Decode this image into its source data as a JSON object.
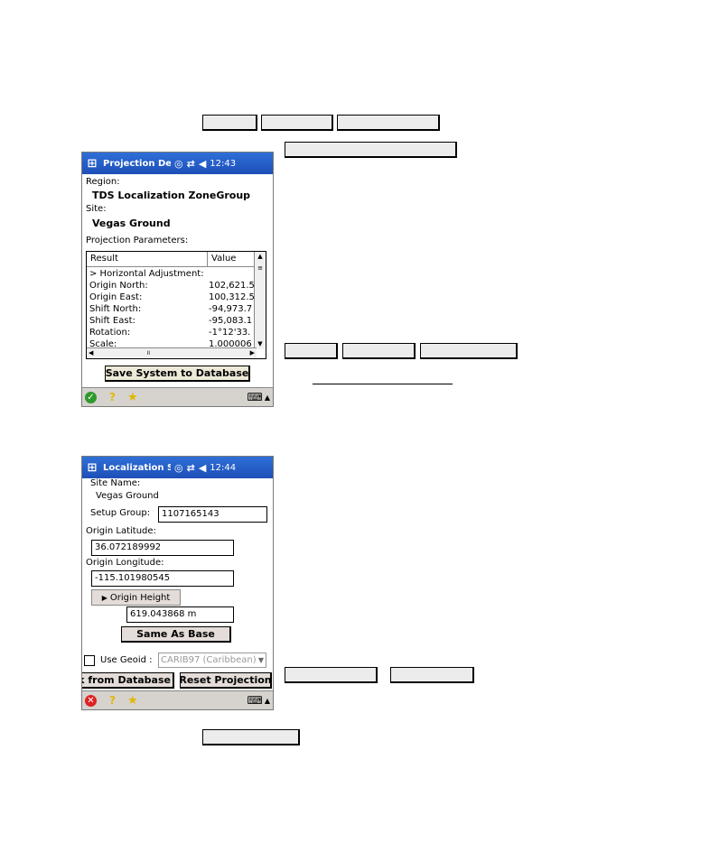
{
  "screen1": {
    "title": "Projection Det",
    "time": "12:43",
    "region_label": "Region:",
    "region_value": "TDS Localization ZoneGroup",
    "site_label": "Site:",
    "site_value": "Vegas Ground",
    "params_label": "Projection Parameters:",
    "columns": [
      "Result",
      "Value"
    ],
    "rows": [
      {
        "result": "> Horizontal Adjustment:",
        "value": ""
      },
      {
        "result": "Origin North:",
        "value": "102,621.5"
      },
      {
        "result": "Origin East:",
        "value": "100,312.5"
      },
      {
        "result": "Shift North:",
        "value": "-94,973.7"
      },
      {
        "result": "Shift East:",
        "value": "-95,083.1"
      },
      {
        "result": "Rotation:",
        "value": "-1°12'33."
      },
      {
        "result": "Scale:",
        "value": "1.000006"
      }
    ],
    "save_button": "Save System to Database"
  },
  "screen2": {
    "title": "Localization Se",
    "time": "12:44",
    "site_name_label": "Site Name:",
    "site_name_value": "Vegas Ground",
    "setup_group_label": "Setup Group:",
    "setup_group_value": "1107165143",
    "origin_lat_label": "Origin Latitude:",
    "origin_lat_value": "36.072189992",
    "origin_lon_label": "Origin Longitude:",
    "origin_lon_value": "-115.101980545",
    "origin_height_button": "Origin Height",
    "origin_height_value": "619.043868 m",
    "same_as_base_button": "Same As Base",
    "use_geoid_label": "Use Geoid :",
    "geoid_select": "CARIB97 (Caribbean)",
    "pick_button": "Pick from Database",
    "reset_button": "Reset Projection"
  }
}
